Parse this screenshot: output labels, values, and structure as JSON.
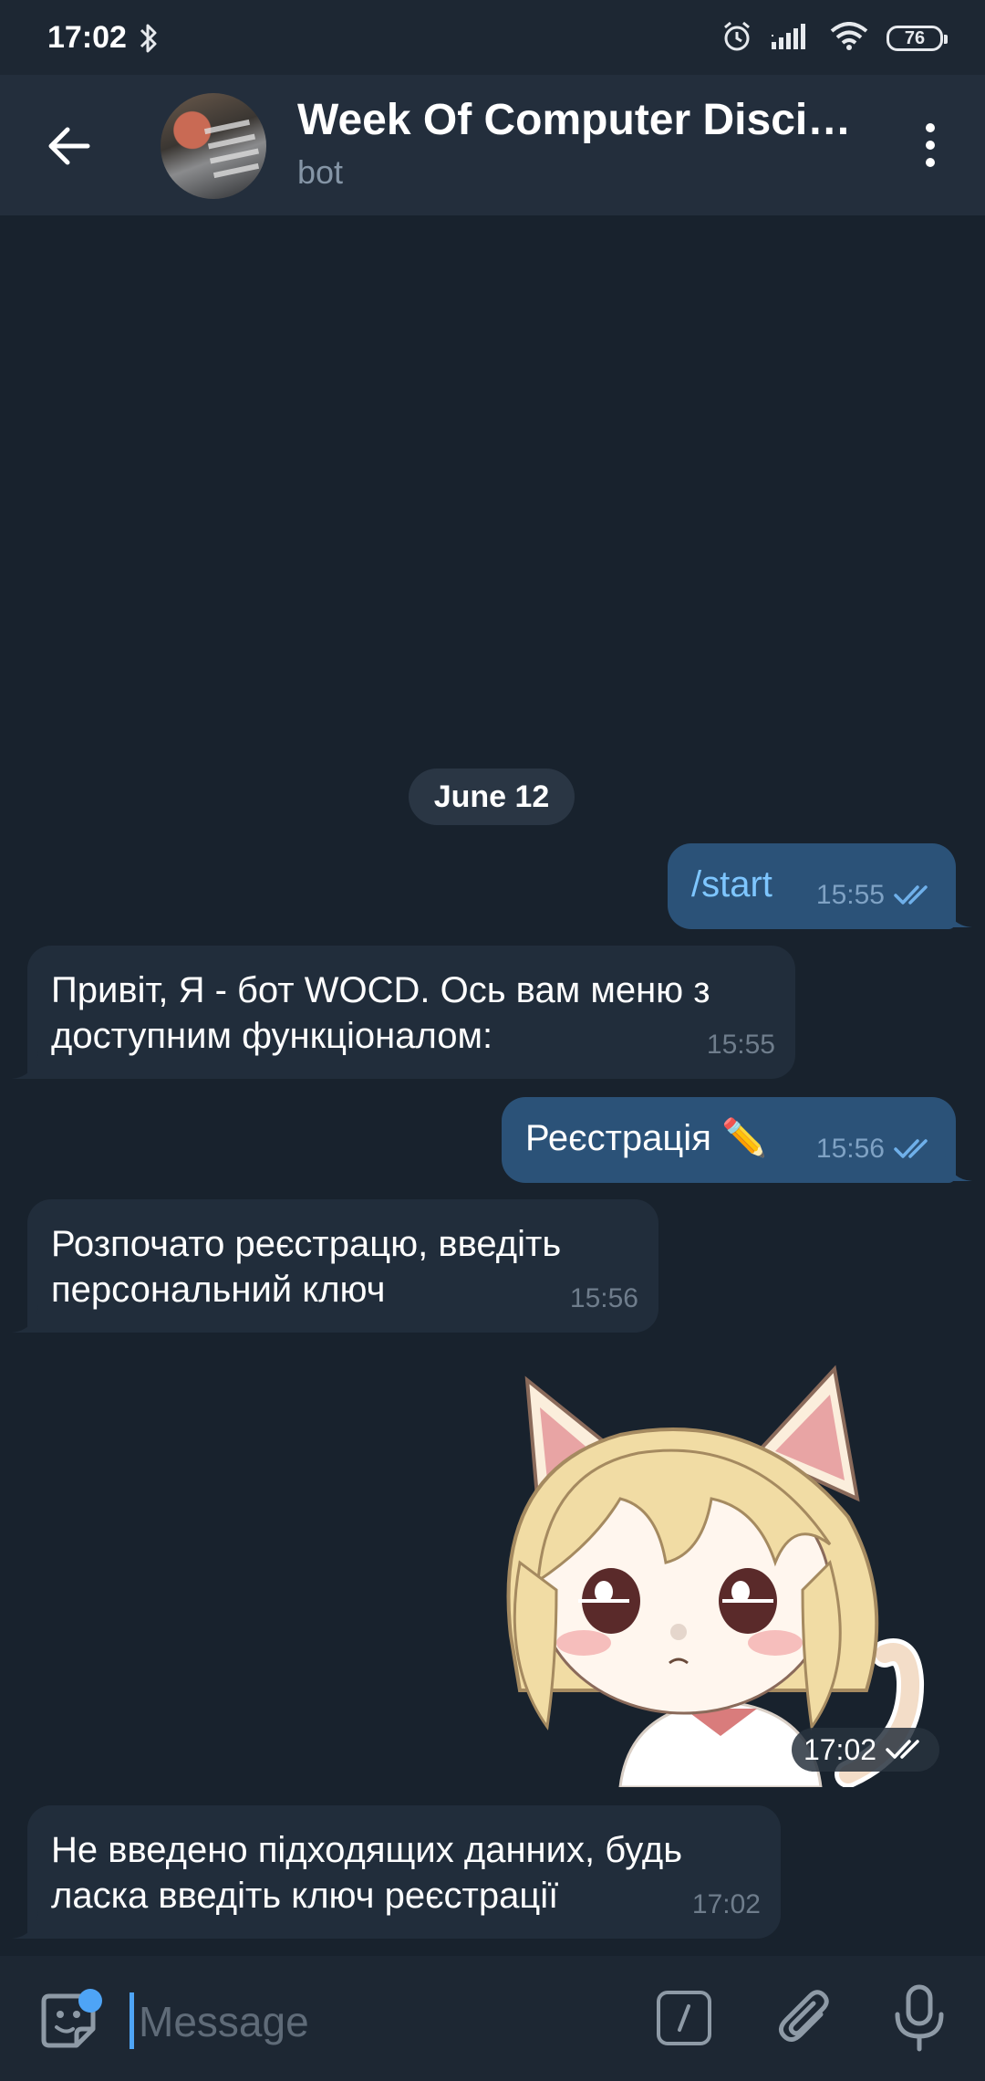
{
  "statusbar": {
    "time": "17:02",
    "battery": "76",
    "icons": [
      "bluetooth-icon",
      "alarm-icon",
      "signal-icon",
      "wifi-icon",
      "battery-icon"
    ]
  },
  "header": {
    "title": "Week Of Computer Discipl…",
    "subtitle": "bot"
  },
  "date_chip": "June 12",
  "messages": [
    {
      "dir": "out",
      "text": "/start",
      "time": "15:55",
      "status": "read"
    },
    {
      "dir": "in",
      "lines": [
        "Привіт, Я - бот WOCD. Ось вам меню з",
        "доступним функціоналом:"
      ],
      "time": "15:55"
    },
    {
      "dir": "out",
      "text": "Реєстрація ✏️",
      "time": "15:56",
      "status": "read"
    },
    {
      "dir": "in",
      "lines": [
        "Розпочато реєстрацю, введіть",
        "персональний ключ"
      ],
      "time": "15:56"
    },
    {
      "dir": "out",
      "type": "sticker",
      "sticker": "cat-girl-sticker",
      "time": "17:02",
      "status": "read"
    },
    {
      "dir": "in",
      "lines": [
        "Не введено підходящих данних, будь",
        "ласка введіть ключ реєстрації"
      ],
      "time": "17:02"
    }
  ],
  "composer": {
    "placeholder": "Message",
    "value": ""
  },
  "colors": {
    "background": "#18222d",
    "appbar": "#232e3c",
    "outgoing": "#2b5278",
    "incoming": "#212d3b",
    "accent": "#4ea4f6",
    "command": "#7ec6ff"
  }
}
